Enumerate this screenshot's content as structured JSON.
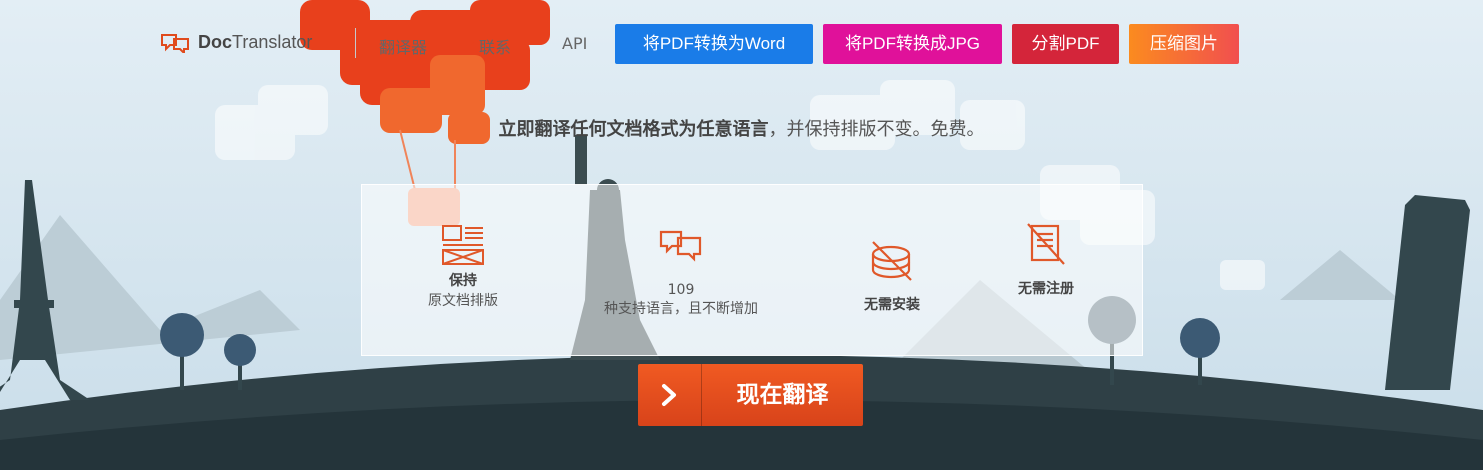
{
  "nav": {
    "logo_text_bold": "Doc",
    "logo_text": "Translator",
    "links": [
      "翻译器",
      "联系",
      "API"
    ],
    "pills": [
      {
        "label": "将PDF转换为Word",
        "color": "#1a7ce8"
      },
      {
        "label": "将PDF转换成JPG",
        "color": "#e0119a"
      },
      {
        "label": "分割PDF",
        "color": "#d4253a"
      },
      {
        "label": "压缩图片",
        "color": "#f56a3c"
      }
    ]
  },
  "tagline": {
    "bold": "立即翻译任何文档格式为任意语言",
    "rest": "，并保持排版不变。免费。"
  },
  "features": [
    {
      "icon": "layout-icon",
      "title": "保持",
      "sub": "原文档排版"
    },
    {
      "icon": "translate-bubbles-icon",
      "title": "109",
      "sub": "种支持语言，且不断增加"
    },
    {
      "icon": "no-install-icon",
      "title": "无需安装",
      "sub": ""
    },
    {
      "icon": "no-register-icon",
      "title": "无需注册",
      "sub": ""
    }
  ],
  "cta": {
    "label": "现在翻译",
    "icon": "chevron-right-icon"
  },
  "colors": {
    "accent": "#e85020",
    "ground": "#2a3a3f",
    "sky": "#d6e6f0"
  }
}
